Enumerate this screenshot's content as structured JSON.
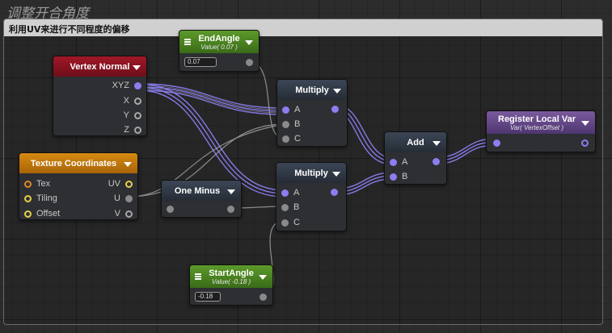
{
  "graph_title": "调整开合角度",
  "comment": {
    "title": "利用UV来进行不同程度的偏移"
  },
  "colors": {
    "wire": "#8a7ef0",
    "vertex_normal_header": "#a01828",
    "texture_coordinates_header": "#d68a10",
    "parameter_header": "#5c9a2a",
    "register_header": "#7a5a9e",
    "default_header": "#2f3845"
  },
  "nodes": {
    "end_angle": {
      "title": "EndAngle",
      "subtitle": "Value( 0.07 )",
      "value": "0.07",
      "icon": "menu-icon"
    },
    "vertex_normal": {
      "title": "Vertex Normal",
      "outputs": [
        "XYZ",
        "X",
        "Y",
        "Z"
      ]
    },
    "multiply_top": {
      "title": "Multiply",
      "inputs": [
        "A",
        "B",
        "C"
      ]
    },
    "texture_coordinates": {
      "title": "Texture Coordinates",
      "inputs": [
        "Tex",
        "Tiling",
        "Offset"
      ],
      "outputs": [
        "UV",
        "U",
        "V"
      ]
    },
    "one_minus": {
      "title": "One Minus"
    },
    "multiply_bottom": {
      "title": "Multiply",
      "inputs": [
        "A",
        "B",
        "C"
      ]
    },
    "add": {
      "title": "Add",
      "inputs": [
        "A",
        "B"
      ]
    },
    "register_local_var": {
      "title": "Register Local Var",
      "subtitle": "Var( VertexOffset )"
    },
    "start_angle": {
      "title": "StartAngle",
      "subtitle": "Value( -0.18 )",
      "value": "-0.18",
      "icon": "menu-icon"
    }
  }
}
